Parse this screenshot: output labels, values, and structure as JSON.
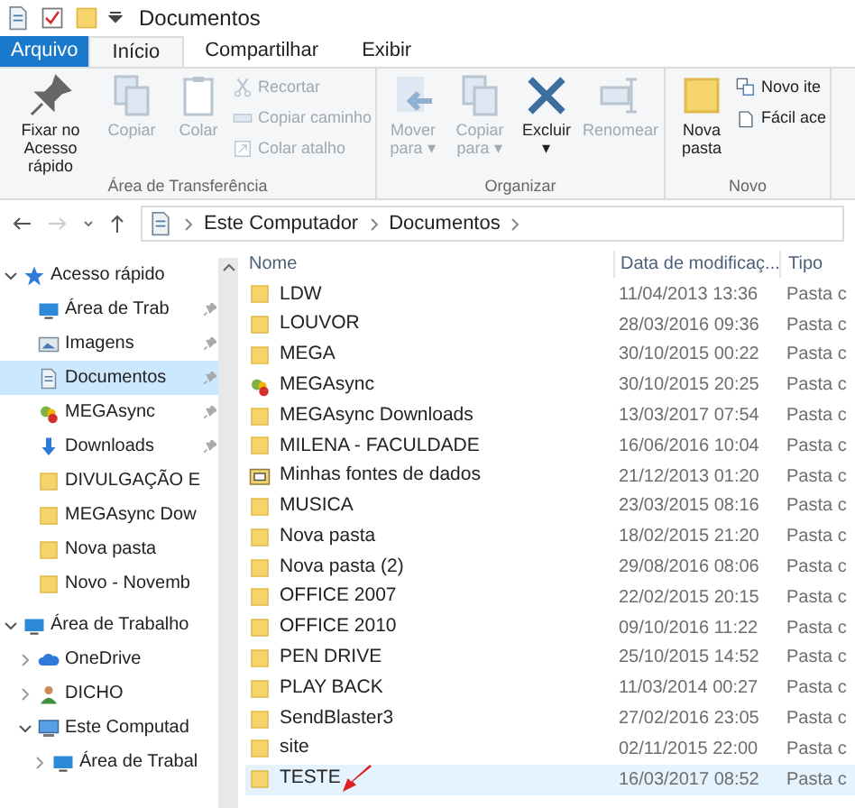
{
  "window": {
    "title": "Documentos"
  },
  "tabs": [
    {
      "label": "Arquivo",
      "kind": "file",
      "selected": false
    },
    {
      "label": "Início",
      "kind": "tab",
      "selected": true
    },
    {
      "label": "Compartilhar",
      "kind": "tab",
      "selected": false
    },
    {
      "label": "Exibir",
      "kind": "tab",
      "selected": false
    }
  ],
  "ribbon_groups": [
    {
      "label": "Área de Transferência",
      "large": [
        {
          "label": "Fixar no Acesso rápido",
          "kind": "pin",
          "disabled": false
        },
        {
          "label": "Copiar",
          "kind": "copy",
          "disabled": true
        },
        {
          "label": "Colar",
          "kind": "paste",
          "disabled": true
        }
      ],
      "small": [
        {
          "label": "Recortar",
          "kind": "cut",
          "disabled": true
        },
        {
          "label": "Copiar caminho",
          "kind": "path",
          "disabled": true
        },
        {
          "label": "Colar atalho",
          "kind": "shortcut",
          "disabled": true
        }
      ]
    },
    {
      "label": "Organizar",
      "large": [
        {
          "label": "Mover para ▾",
          "kind": "move",
          "disabled": true
        },
        {
          "label": "Copiar para ▾",
          "kind": "copyto",
          "disabled": true
        },
        {
          "label": "Excluir ▾",
          "kind": "delete",
          "disabled": false
        },
        {
          "label": "Renomear",
          "kind": "rename",
          "disabled": true
        }
      ]
    },
    {
      "label": "Novo",
      "large": [
        {
          "label": "Nova pasta",
          "kind": "folder",
          "disabled": false
        }
      ],
      "small": [
        {
          "label": "Novo ite",
          "kind": "newitem",
          "disabled": false
        },
        {
          "label": "Fácil ace",
          "kind": "easy",
          "disabled": false
        }
      ]
    }
  ],
  "address": {
    "crumbs": [
      "Este Computador",
      "Documentos"
    ]
  },
  "nav_tree": [
    {
      "label": "Acesso rápido",
      "kind": "star",
      "expanded": true,
      "selected": false,
      "children": [
        {
          "label": "Área de Trab",
          "kind": "desktop",
          "pinned": true,
          "selected": false
        },
        {
          "label": "Imagens",
          "kind": "pictures",
          "pinned": true,
          "selected": false
        },
        {
          "label": "Documentos",
          "kind": "document",
          "pinned": true,
          "selected": true
        },
        {
          "label": "MEGAsync",
          "kind": "mega",
          "pinned": true,
          "selected": false
        },
        {
          "label": "Downloads",
          "kind": "download",
          "pinned": true,
          "selected": false
        },
        {
          "label": "DIVULGAÇÃO E",
          "kind": "folder",
          "pinned": false,
          "selected": false
        },
        {
          "label": "MEGAsync Dow",
          "kind": "folder",
          "pinned": false,
          "selected": false
        },
        {
          "label": "Nova pasta",
          "kind": "folder",
          "pinned": false,
          "selected": false
        },
        {
          "label": "Novo - Novemb",
          "kind": "folder",
          "pinned": false,
          "selected": false
        }
      ]
    },
    {
      "label": "Área de Trabalho",
      "kind": "desktop",
      "expanded": true,
      "selected": false,
      "children": [
        {
          "label": "OneDrive",
          "kind": "cloud",
          "expanded": false,
          "selected": false
        },
        {
          "label": "DICHO",
          "kind": "user",
          "expanded": false,
          "selected": false
        },
        {
          "label": "Este Computad",
          "kind": "computer",
          "expanded": true,
          "selected": false,
          "children": [
            {
              "label": "Área de Trabal",
              "kind": "desktop",
              "expanded": false,
              "selected": false
            }
          ]
        }
      ]
    }
  ],
  "file_list": {
    "columns": [
      "Nome",
      "Data de modificaç...",
      "Tipo"
    ],
    "rows": [
      {
        "name": "LDW",
        "kind": "folder",
        "date": "11/04/2013 13:36",
        "type": "Pasta c",
        "selected": false
      },
      {
        "name": "LOUVOR",
        "kind": "folder",
        "date": "28/03/2016 09:36",
        "type": "Pasta c",
        "selected": false
      },
      {
        "name": "MEGA",
        "kind": "folder",
        "date": "30/10/2015 00:22",
        "type": "Pasta c",
        "selected": false
      },
      {
        "name": "MEGAsync",
        "kind": "mega",
        "date": "30/10/2015 20:25",
        "type": "Pasta c",
        "selected": false
      },
      {
        "name": "MEGAsync Downloads",
        "kind": "folder",
        "date": "13/03/2017 07:54",
        "type": "Pasta c",
        "selected": false
      },
      {
        "name": "MILENA - FACULDADE",
        "kind": "folder",
        "date": "16/06/2016 10:04",
        "type": "Pasta c",
        "selected": false
      },
      {
        "name": "Minhas fontes de dados",
        "kind": "datasource",
        "date": "21/12/2013 01:20",
        "type": "Pasta c",
        "selected": false
      },
      {
        "name": "MUSICA",
        "kind": "folder",
        "date": "23/03/2015 08:16",
        "type": "Pasta c",
        "selected": false
      },
      {
        "name": "Nova pasta",
        "kind": "folder",
        "date": "18/02/2015 21:20",
        "type": "Pasta c",
        "selected": false
      },
      {
        "name": "Nova pasta (2)",
        "kind": "folder",
        "date": "29/08/2016 08:06",
        "type": "Pasta c",
        "selected": false
      },
      {
        "name": "OFFICE 2007",
        "kind": "folder",
        "date": "22/02/2015 20:15",
        "type": "Pasta c",
        "selected": false
      },
      {
        "name": "OFFICE 2010",
        "kind": "folder",
        "date": "09/10/2016 11:22",
        "type": "Pasta c",
        "selected": false
      },
      {
        "name": "PEN DRIVE",
        "kind": "folder",
        "date": "25/10/2015 14:52",
        "type": "Pasta c",
        "selected": false
      },
      {
        "name": "PLAY BACK",
        "kind": "folder",
        "date": "11/03/2014 00:27",
        "type": "Pasta c",
        "selected": false
      },
      {
        "name": "SendBlaster3",
        "kind": "folder",
        "date": "27/02/2016 23:05",
        "type": "Pasta c",
        "selected": false
      },
      {
        "name": "site",
        "kind": "folder",
        "date": "02/11/2015 22:00",
        "type": "Pasta c",
        "selected": false
      },
      {
        "name": "TESTE",
        "kind": "folder",
        "date": "16/03/2017 08:52",
        "type": "Pasta c",
        "selected": true,
        "annotated": true
      }
    ]
  }
}
